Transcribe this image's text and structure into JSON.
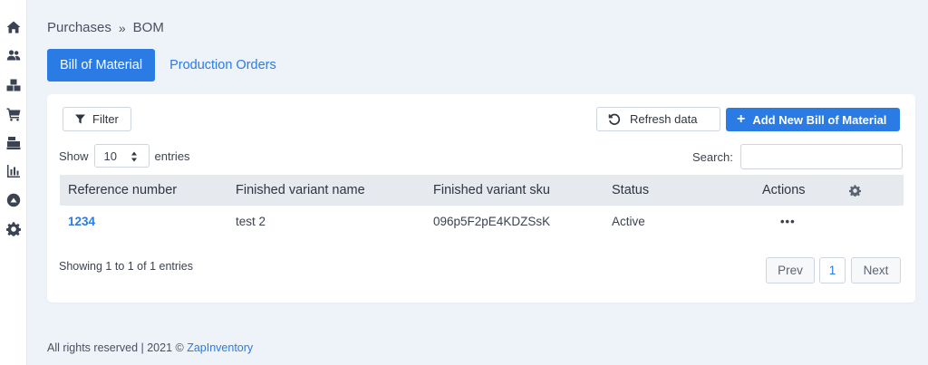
{
  "sidebar": {
    "items": [
      {
        "icon": "home-icon"
      },
      {
        "icon": "users-icon"
      },
      {
        "icon": "boxes-icon"
      },
      {
        "icon": "cart-icon"
      },
      {
        "icon": "cash-register-icon"
      },
      {
        "icon": "chart-icon"
      },
      {
        "icon": "circle-up-icon"
      },
      {
        "icon": "gear-icon"
      }
    ]
  },
  "breadcrumb": {
    "parent": "Purchases",
    "separator": "»",
    "current": "BOM"
  },
  "tabs": [
    {
      "label": "Bill of Material",
      "active": true
    },
    {
      "label": "Production Orders",
      "active": false
    }
  ],
  "toolbar": {
    "filter_label": "Filter",
    "refresh_label": "Refresh data",
    "add_label": "Add New Bill of Material"
  },
  "length": {
    "show_label": "Show",
    "value": "10",
    "entries_label": "entries"
  },
  "search": {
    "label": "Search:",
    "value": ""
  },
  "table": {
    "columns": [
      "Reference number",
      "Finished variant name",
      "Finished variant sku",
      "Status",
      "Actions"
    ],
    "rows": [
      {
        "reference": "1234",
        "name": "test 2",
        "sku": "096p5F2pE4KDZSsK",
        "status": "Active",
        "actions": "•••"
      }
    ]
  },
  "info": "Showing 1 to 1 of 1 entries",
  "pagination": {
    "prev": "Prev",
    "page": "1",
    "next": "Next"
  },
  "footer": {
    "text": "All rights reserved | 2021 © ",
    "link": "ZapInventory"
  },
  "colors": {
    "accent": "#2b7be4",
    "background": "#eef2f9",
    "header_row": "#e6e9ee"
  }
}
